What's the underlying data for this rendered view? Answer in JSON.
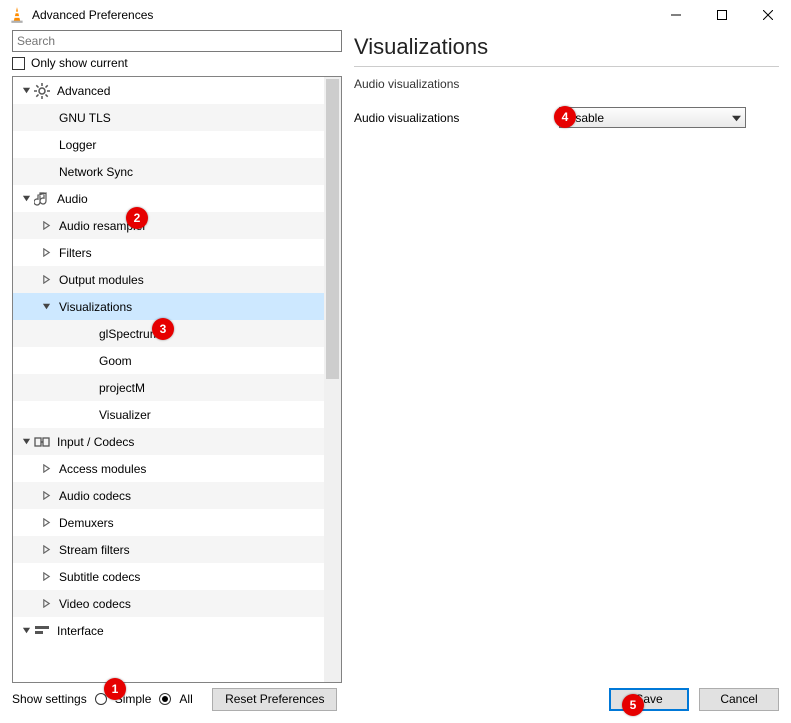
{
  "window": {
    "title": "Advanced Preferences"
  },
  "search": {
    "placeholder": "Search"
  },
  "only_show_current": {
    "label": "Only show current"
  },
  "tree": {
    "items": [
      {
        "label": "Advanced",
        "depth": 0,
        "arrow": "down",
        "icon": "gear"
      },
      {
        "label": "GNU TLS",
        "depth": 1,
        "arrow": "",
        "icon": ""
      },
      {
        "label": "Logger",
        "depth": 1,
        "arrow": "",
        "icon": ""
      },
      {
        "label": "Network Sync",
        "depth": 1,
        "arrow": "",
        "icon": ""
      },
      {
        "label": "Audio",
        "depth": 0,
        "arrow": "down",
        "icon": "audio"
      },
      {
        "label": "Audio resampler",
        "depth": 1,
        "arrow": "right",
        "icon": ""
      },
      {
        "label": "Filters",
        "depth": 1,
        "arrow": "right",
        "icon": ""
      },
      {
        "label": "Output modules",
        "depth": 1,
        "arrow": "right",
        "icon": ""
      },
      {
        "label": "Visualizations",
        "depth": 1,
        "arrow": "down",
        "icon": "",
        "selected": true
      },
      {
        "label": "glSpectrum",
        "depth": 2,
        "arrow": "",
        "icon": ""
      },
      {
        "label": "Goom",
        "depth": 2,
        "arrow": "",
        "icon": ""
      },
      {
        "label": "projectM",
        "depth": 2,
        "arrow": "",
        "icon": ""
      },
      {
        "label": "Visualizer",
        "depth": 2,
        "arrow": "",
        "icon": ""
      },
      {
        "label": "Input / Codecs",
        "depth": 0,
        "arrow": "down",
        "icon": "codec"
      },
      {
        "label": "Access modules",
        "depth": 1,
        "arrow": "right",
        "icon": ""
      },
      {
        "label": "Audio codecs",
        "depth": 1,
        "arrow": "right",
        "icon": ""
      },
      {
        "label": "Demuxers",
        "depth": 1,
        "arrow": "right",
        "icon": ""
      },
      {
        "label": "Stream filters",
        "depth": 1,
        "arrow": "right",
        "icon": ""
      },
      {
        "label": "Subtitle codecs",
        "depth": 1,
        "arrow": "right",
        "icon": ""
      },
      {
        "label": "Video codecs",
        "depth": 1,
        "arrow": "right",
        "icon": ""
      },
      {
        "label": "Interface",
        "depth": 0,
        "arrow": "down",
        "icon": "interface"
      }
    ]
  },
  "panel": {
    "heading": "Visualizations",
    "subheading": "Audio visualizations",
    "setting_label": "Audio visualizations",
    "setting_value": "Disable"
  },
  "footer": {
    "show_settings_label": "Show settings",
    "radio_simple": "Simple",
    "radio_all": "All",
    "reset_label": "Reset Preferences",
    "save_label": "Save",
    "cancel_label": "Cancel"
  },
  "annotations": [
    "1",
    "2",
    "3",
    "4",
    "5"
  ]
}
